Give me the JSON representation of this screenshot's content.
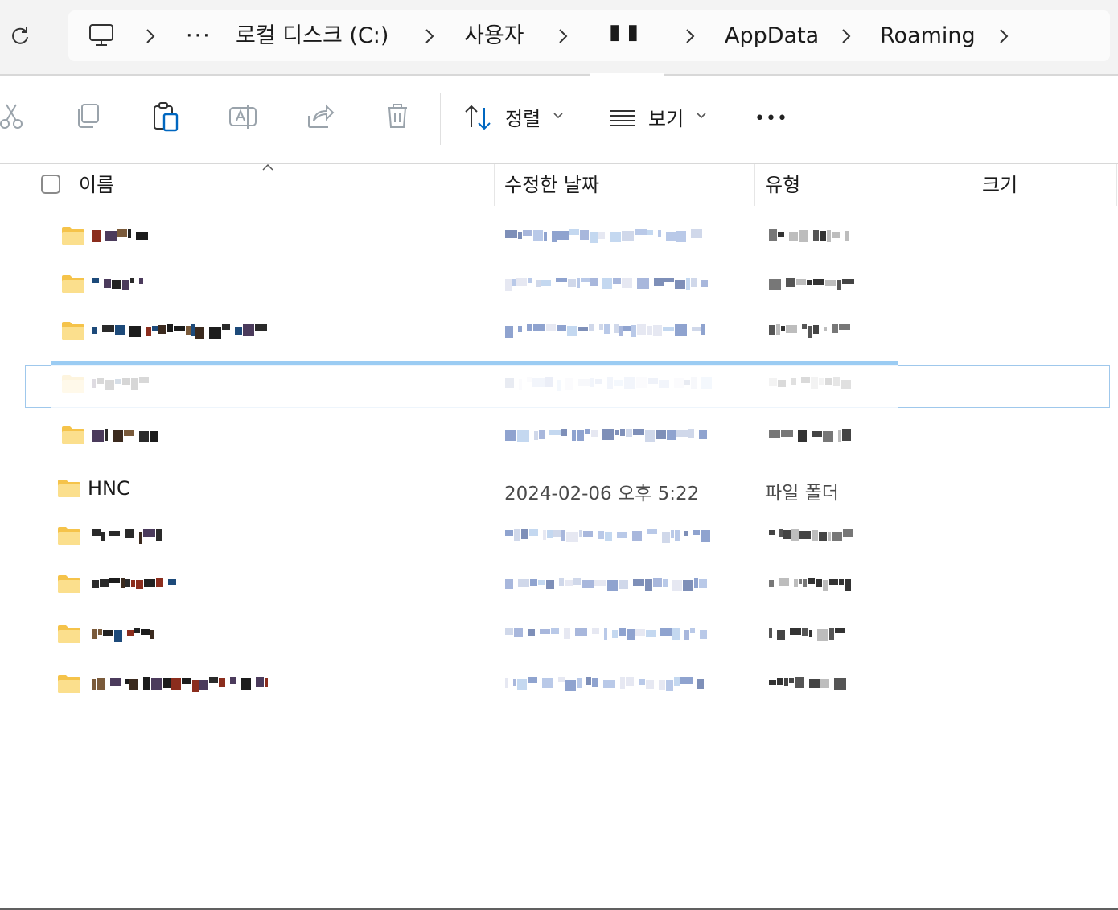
{
  "breadcrumb": {
    "items": [
      {
        "label": "로컬 디스크 (C:)"
      },
      {
        "label": "사용자"
      },
      {
        "label": "▮ ▮"
      },
      {
        "label": "AppData"
      },
      {
        "label": "Roaming"
      }
    ],
    "overflow_label": "···"
  },
  "toolbar": {
    "sort_label": "정렬",
    "view_label": "보기",
    "more_label": "•••"
  },
  "columns": {
    "name": "이름",
    "date": "수정한 날짜",
    "type": "유형",
    "size": "크기"
  },
  "rows": [
    {
      "name": "",
      "date": "",
      "type": "",
      "obscured": true
    },
    {
      "name": "",
      "date": "",
      "type": "",
      "obscured": true
    },
    {
      "name": "",
      "date": "",
      "type": "",
      "obscured": true
    },
    {
      "name": "",
      "date": "",
      "type": "",
      "obscured": true,
      "selected": true
    },
    {
      "name": "",
      "date": "",
      "type": "",
      "obscured": true
    },
    {
      "name": "HNC",
      "date": "2024-02-06 오후 5:22",
      "type": "파일 폴더",
      "obscured": false
    },
    {
      "name": "",
      "date": "",
      "type": "",
      "obscured": true
    },
    {
      "name": "",
      "date": "",
      "type": "",
      "obscured": true
    },
    {
      "name": "",
      "date": "",
      "type": "",
      "obscured": true
    },
    {
      "name": "",
      "date": "",
      "type": "",
      "obscured": true
    }
  ],
  "colors": {
    "folder": "#f5c34a",
    "folder_light": "#fbdf8d",
    "selection_border": "#9fc8ec",
    "drag_indicator": "#9bccf3",
    "accent": "#0067c0"
  },
  "icons": [
    "refresh-icon",
    "computer-icon",
    "chevron-right-icon",
    "cut-icon",
    "copy-icon",
    "paste-icon",
    "rename-icon",
    "share-icon",
    "delete-icon",
    "sort-icon",
    "view-icon",
    "chevron-down-icon",
    "more-icon",
    "folder-icon"
  ]
}
